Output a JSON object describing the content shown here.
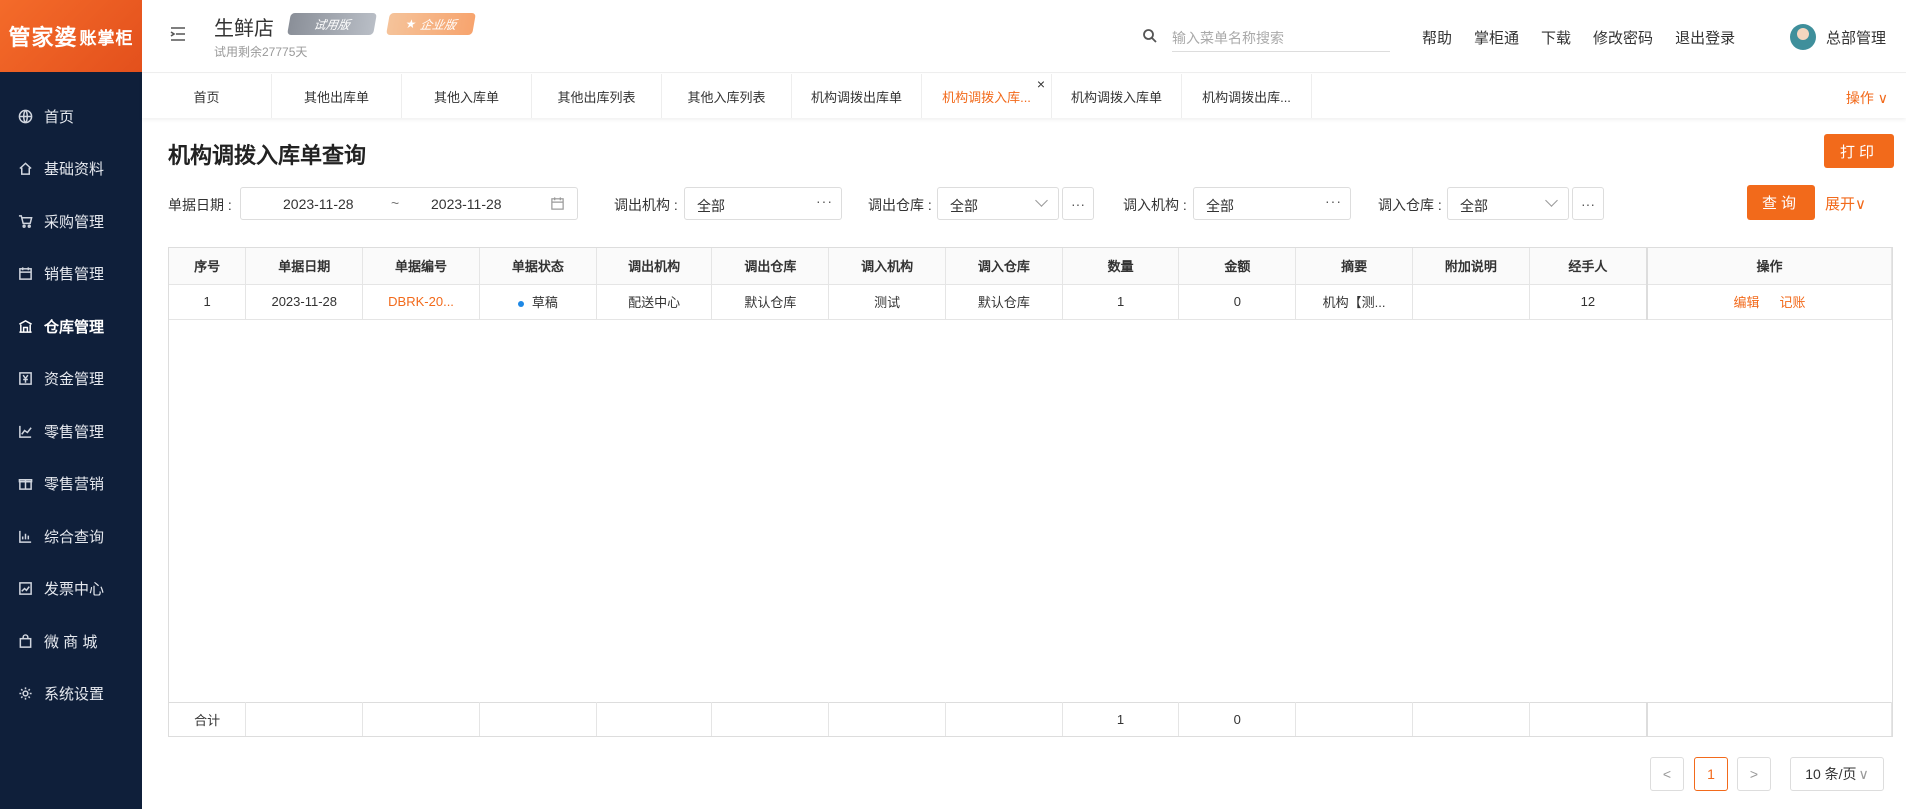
{
  "sidebar": {
    "logo_main": "管家婆",
    "logo_sub": "账掌柜",
    "items": [
      {
        "label": "首页",
        "icon": "globe-icon"
      },
      {
        "label": "基础资料",
        "icon": "home-icon"
      },
      {
        "label": "采购管理",
        "icon": "cart-icon"
      },
      {
        "label": "销售管理",
        "icon": "calendar-icon"
      },
      {
        "label": "仓库管理",
        "icon": "warehouse-icon"
      },
      {
        "label": "资金管理",
        "icon": "yuan-icon"
      },
      {
        "label": "零售管理",
        "icon": "chart-icon"
      },
      {
        "label": "零售营销",
        "icon": "gift-icon"
      },
      {
        "label": "综合查询",
        "icon": "bar-chart-icon"
      },
      {
        "label": "发票中心",
        "icon": "invoice-icon"
      },
      {
        "label": "微 商 城",
        "icon": "bag-icon"
      },
      {
        "label": "系统设置",
        "icon": "gear-icon"
      }
    ],
    "active_index": 4
  },
  "header": {
    "store_name": "生鲜店",
    "badge_trial": "试用版",
    "badge_enterprise": "企业版",
    "trial_left": "试用剩余27775天",
    "search_placeholder": "输入菜单名称搜索",
    "links": [
      "帮助",
      "掌柜通",
      "下载",
      "修改密码",
      "退出登录"
    ],
    "user_name": "总部管理"
  },
  "tabs": {
    "items": [
      "首页",
      "其他出库单",
      "其他入库单",
      "其他出库列表",
      "其他入库列表",
      "机构调拨出库单",
      "机构调拨入库...",
      "机构调拨入库单",
      "机构调拨出库..."
    ],
    "active_index": 6,
    "close": "×",
    "ops_label": "操作 ∨"
  },
  "page": {
    "title": "机构调拨入库单查询",
    "print_label": "打印",
    "query_label": "查询",
    "expand_label": "展开∨"
  },
  "filters": {
    "date_label": "单据日期 :",
    "date_from": "2023-11-28",
    "date_sep": "~",
    "date_to": "2023-11-28",
    "out_org_label": "调出机构 :",
    "out_org_value": "全部",
    "out_wh_label": "调出仓库 :",
    "out_wh_value": "全部",
    "in_org_label": "调入机构 :",
    "in_org_value": "全部",
    "in_wh_label": "调入仓库 :",
    "in_wh_value": "全部",
    "more": "···"
  },
  "table": {
    "columns": [
      "序号",
      "单据日期",
      "单据编号",
      "单据状态",
      "调出机构",
      "调出仓库",
      "调入机构",
      "调入仓库",
      "数量",
      "金额",
      "摘要",
      "附加说明",
      "经手人",
      "操作"
    ],
    "rows": [
      {
        "no": "1",
        "date": "2023-11-28",
        "code": "DBRK-20...",
        "status": "草稿",
        "out_org": "配送中心",
        "out_wh": "默认仓库",
        "in_org": "测试",
        "in_wh": "默认仓库",
        "qty": "1",
        "amount": "0",
        "summary": "机构【测...",
        "note": "",
        "handler": "12",
        "op_edit": "编辑",
        "op_post": "记账"
      }
    ],
    "sum_label": "合计",
    "sum_qty": "1",
    "sum_amount": "0"
  },
  "pagination": {
    "prev": "<",
    "current": "1",
    "next": ">",
    "page_size": "10 条/页"
  },
  "colors": {
    "accent": "#f26a1b",
    "sidebar_bg": "#0f1f3a"
  }
}
